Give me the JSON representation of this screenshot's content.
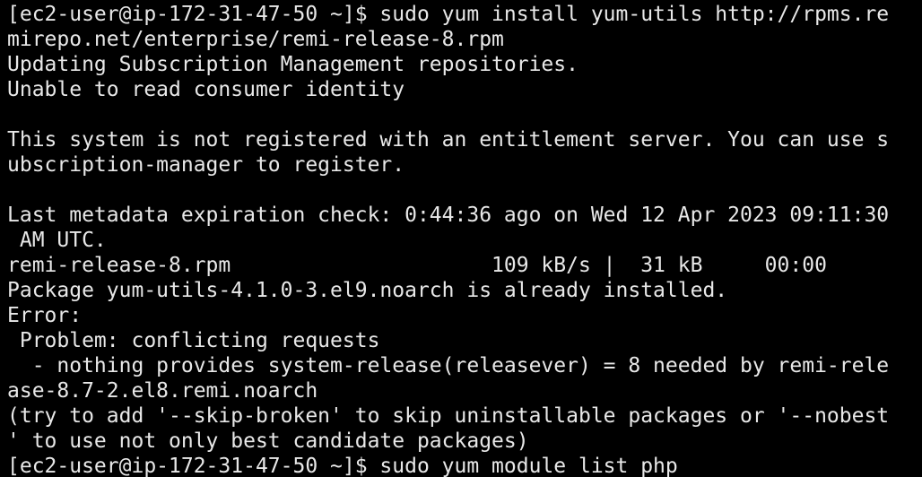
{
  "terminal": {
    "lines": [
      "[ec2-user@ip-172-31-47-50 ~]$ sudo yum install yum-utils http://rpms.re",
      "mirepo.net/enterprise/remi-release-8.rpm",
      "Updating Subscription Management repositories.",
      "Unable to read consumer identity",
      "",
      "This system is not registered with an entitlement server. You can use s",
      "ubscription-manager to register.",
      "",
      "Last metadata expiration check: 0:44:36 ago on Wed 12 Apr 2023 09:11:30",
      " AM UTC.",
      "remi-release-8.rpm                     109 kB/s |  31 kB     00:00",
      "Package yum-utils-4.1.0-3.el9.noarch is already installed.",
      "Error:",
      " Problem: conflicting requests",
      "  - nothing provides system-release(releasever) = 8 needed by remi-rele",
      "ase-8.7-2.el8.remi.noarch",
      "(try to add '--skip-broken' to skip uninstallable packages or '--nobest",
      "' to use not only best candidate packages)",
      "[ec2-user@ip-172-31-47-50 ~]$ sudo yum module list php"
    ]
  },
  "colors": {
    "background": "#000000",
    "foreground": "#e8e8e8"
  }
}
